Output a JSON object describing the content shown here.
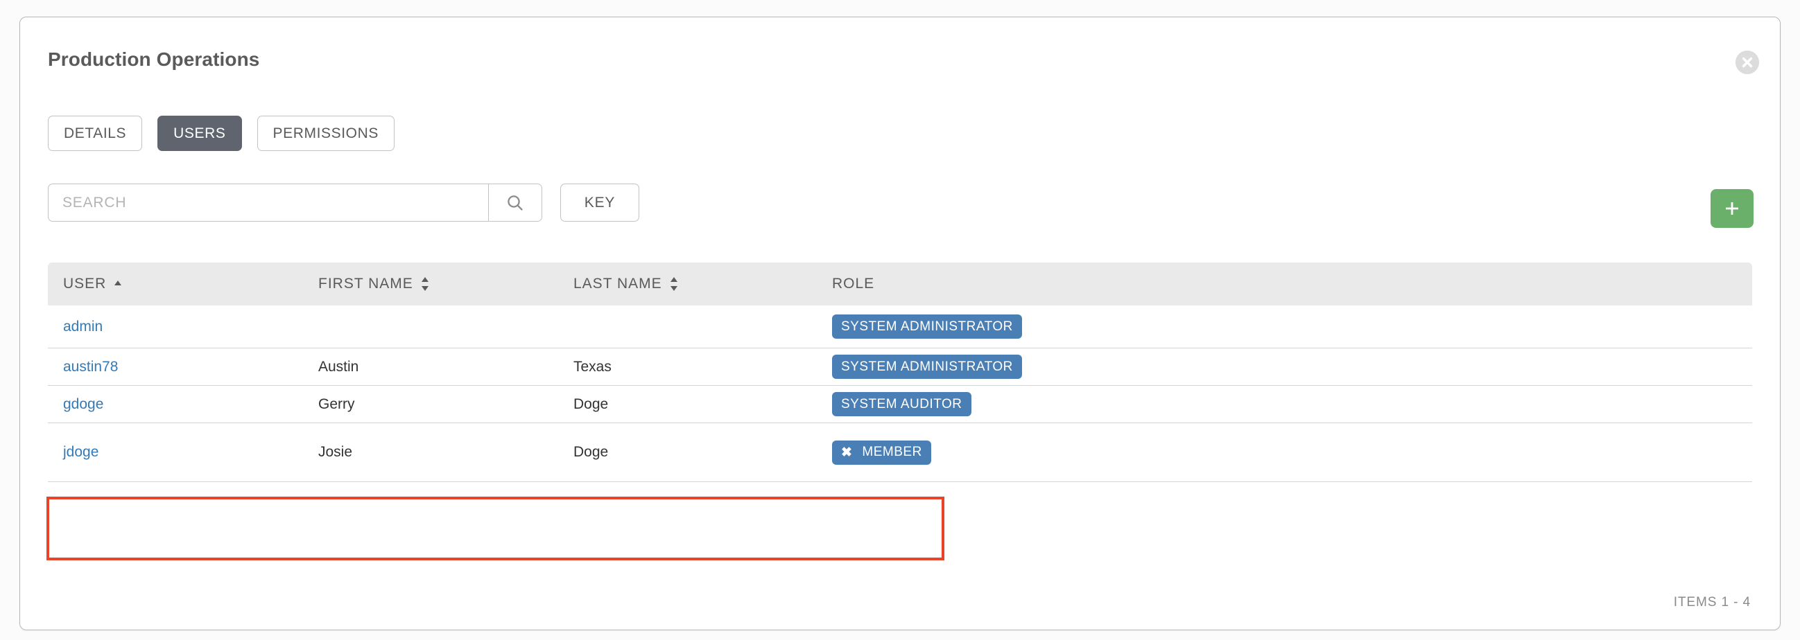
{
  "card": {
    "title": "Production Operations",
    "close_icon": "close-circle-icon"
  },
  "tabs": [
    {
      "label": "DETAILS",
      "active": false
    },
    {
      "label": "USERS",
      "active": true
    },
    {
      "label": "PERMISSIONS",
      "active": false
    }
  ],
  "toolbar": {
    "search_placeholder": "SEARCH",
    "search_value": "",
    "search_icon": "search-icon",
    "key_label": "KEY",
    "add_icon": "plus-icon",
    "add_color": "#6aaf6a"
  },
  "table": {
    "columns": [
      {
        "label": "USER",
        "sort": "asc"
      },
      {
        "label": "FIRST NAME",
        "sort": "none"
      },
      {
        "label": "LAST NAME",
        "sort": "none"
      },
      {
        "label": "ROLE",
        "sort": null
      }
    ],
    "rows": [
      {
        "user": "admin",
        "first_name": "",
        "last_name": "",
        "role": "SYSTEM ADMINISTRATOR",
        "role_removable": false,
        "highlighted": false
      },
      {
        "user": "austin78",
        "first_name": "Austin",
        "last_name": "Texas",
        "role": "SYSTEM ADMINISTRATOR",
        "role_removable": false,
        "highlighted": false
      },
      {
        "user": "gdoge",
        "first_name": "Gerry",
        "last_name": "Doge",
        "role": "SYSTEM AUDITOR",
        "role_removable": false,
        "highlighted": false
      },
      {
        "user": "jdoge",
        "first_name": "Josie",
        "last_name": "Doge",
        "role": "MEMBER",
        "role_removable": true,
        "role_remove_icon": "remove-x-icon",
        "highlighted": true
      }
    ]
  },
  "footer": {
    "items_label": "ITEMS  1 - 4"
  },
  "colors": {
    "badge_blue": "#4a7fb5",
    "link_blue": "#337ab7",
    "active_tab": "#5f646e",
    "annotation_red": "#e8442a",
    "header_band": "#eaeaea"
  }
}
